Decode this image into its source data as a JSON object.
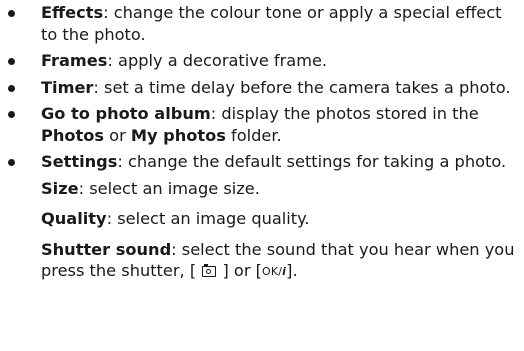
{
  "items": [
    {
      "term": "Effects",
      "desc": ": change the colour tone or apply a special effect to the photo."
    },
    {
      "term": "Frames",
      "desc": ": apply a decorative frame."
    },
    {
      "term": "Timer",
      "desc": ": set a time delay before the camera takes a photo."
    },
    {
      "term": "Go to photo album",
      "desc_a": ": display the photos stored in the ",
      "folder_1": "Photos",
      "desc_or": " or ",
      "folder_2": "My photos",
      "desc_b": " folder."
    },
    {
      "term": "Settings",
      "desc": ": change the default settings for taking a photo."
    }
  ],
  "settings_sub": [
    {
      "term": "Size",
      "desc": ": select an image size."
    },
    {
      "term": "Quality",
      "desc": ": select an image quality."
    },
    {
      "term": "Shutter sound",
      "desc": ": select the sound that you hear when you press the shutter, ",
      "bracket_open": "[",
      "bracket_close": "]",
      "or_text": " or ",
      "key_label": "OK/",
      "key_info": "i",
      "end": "."
    }
  ],
  "icons": {
    "bullet": "filled-circle",
    "camera_key": "camera-icon"
  }
}
